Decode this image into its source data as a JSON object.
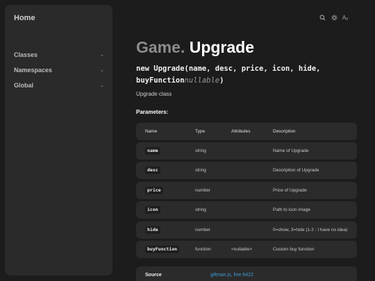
{
  "sidebar": {
    "home_label": "Home",
    "items": [
      {
        "label": "Classes"
      },
      {
        "label": "Namespaces"
      },
      {
        "label": "Global"
      }
    ]
  },
  "toolbar": {
    "icons": [
      "search-icon",
      "gear-icon",
      "text-size-icon"
    ],
    "text_size_glyph": "Aₐ"
  },
  "page": {
    "namespace": "Game.",
    "class_name": "Upgrade",
    "signature_line1": "new Upgrade(name, desc, price, icon, hide,",
    "signature_fn": "buyFunction",
    "signature_nullable": "nullable",
    "signature_end": ")",
    "description": "Upgrade class",
    "params_heading": "Parameters:"
  },
  "params_table": {
    "headers": [
      "Name",
      "Type",
      "Attributes",
      "Description"
    ],
    "rows": [
      {
        "name": "name",
        "type": "string",
        "attributes": "",
        "description": "Name of Upgrade"
      },
      {
        "name": "desc",
        "type": "string",
        "attributes": "",
        "description": "Description of Upgrade"
      },
      {
        "name": "price",
        "type": "number",
        "attributes": "",
        "description": "Price of Upgrade"
      },
      {
        "name": "icon",
        "type": "string",
        "attributes": "",
        "description": "Path to icon image"
      },
      {
        "name": "hide",
        "type": "number",
        "attributes": "",
        "description": "0=show, 3=hide (1-2 : I have no idea)"
      },
      {
        "name": "buyFunction",
        "type": "function",
        "attributes": "<nullable>",
        "description": "Custom buy function"
      }
    ]
  },
  "source": {
    "label": "Source",
    "file": "giltman.js",
    "line_text": ", line 6422"
  },
  "colors": {
    "background": "#1c1c1c",
    "panel": "#2a2a2a",
    "link": "#3d9bd6"
  }
}
